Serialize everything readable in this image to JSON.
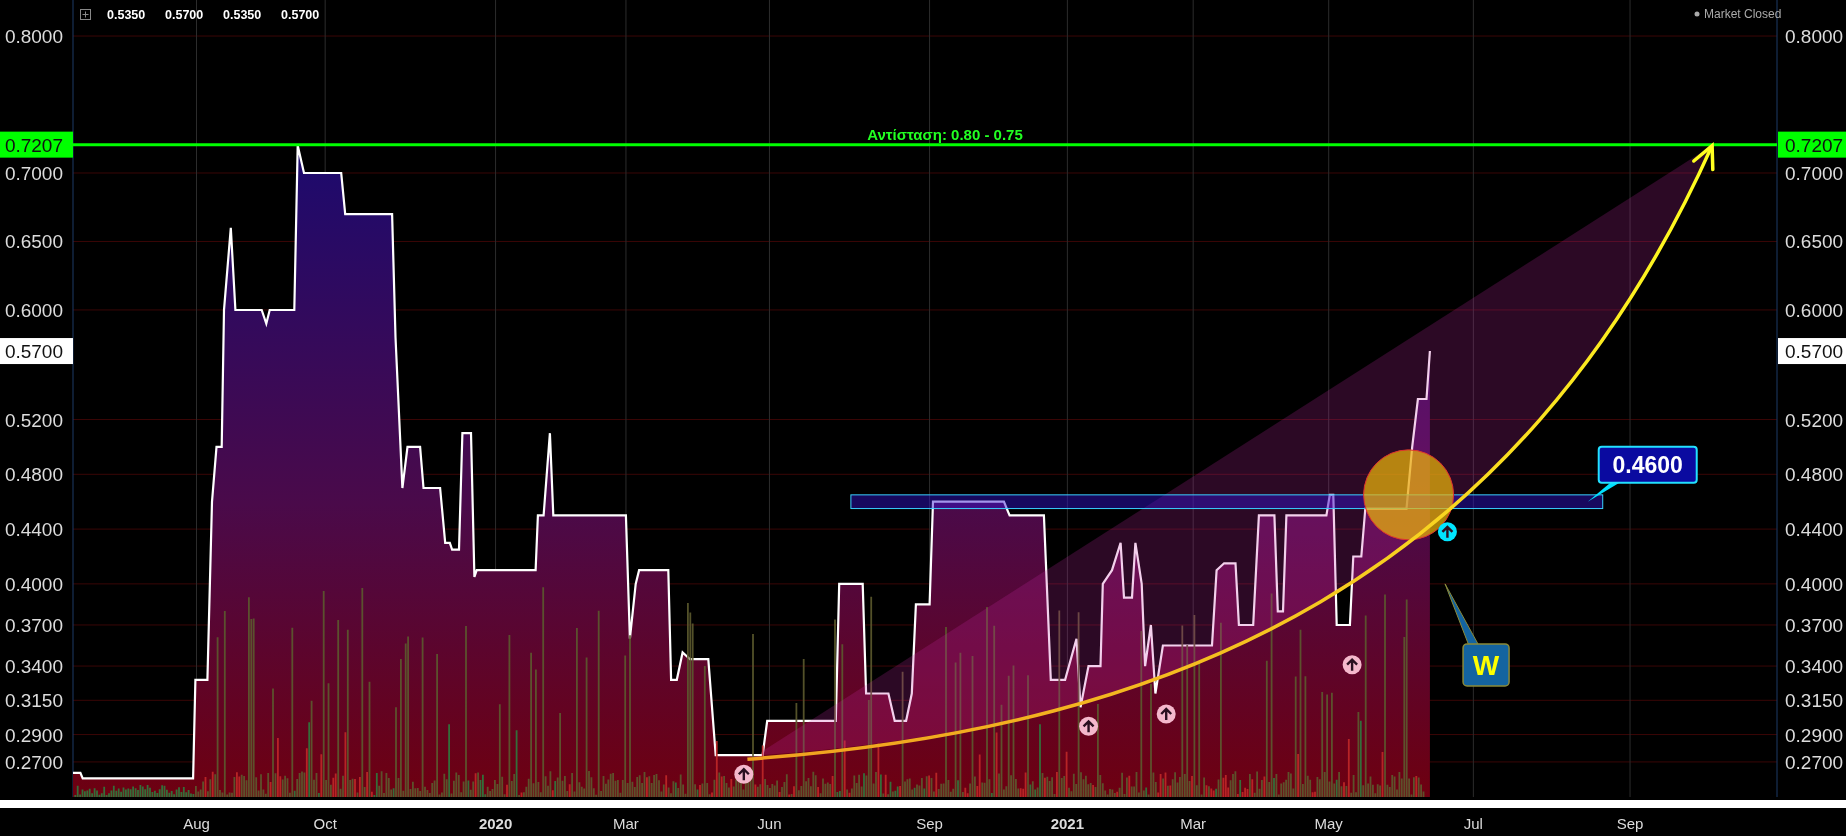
{
  "header": {
    "ohlc": [
      "0.5350",
      "0.5700",
      "0.5350",
      "0.5700"
    ],
    "market_status": "Market Closed"
  },
  "left_tags": [
    {
      "kind": "resistance",
      "label": "0.7207"
    },
    {
      "kind": "last",
      "label": "0.5700"
    }
  ],
  "right_tags": [
    {
      "kind": "resistance",
      "label": "0.7207"
    },
    {
      "kind": "last",
      "label": "0.5700"
    }
  ],
  "chart_data": {
    "type": "area",
    "grid": true,
    "xlim": [
      2019.261,
      2022.241
    ],
    "ylim": [
      0.2444,
      0.8263
    ],
    "xticks": [
      {
        "value": 2019.477,
        "label": "Aug"
      },
      {
        "value": 2019.702,
        "label": "Oct"
      },
      {
        "value": 2020,
        "label": "2020"
      },
      {
        "value": 2020.228,
        "label": "Mar"
      },
      {
        "value": 2020.479,
        "label": "Jun"
      },
      {
        "value": 2020.759,
        "label": "Sep"
      },
      {
        "value": 2021,
        "label": "2021"
      },
      {
        "value": 2021.22,
        "label": "Mar"
      },
      {
        "value": 2021.457,
        "label": "May"
      },
      {
        "value": 2021.71,
        "label": "Jul"
      },
      {
        "value": 2021.984,
        "label": "Sep"
      }
    ],
    "yticks": [
      {
        "value": 0.8,
        "label": "0.8000"
      },
      {
        "value": 0.7,
        "label": "0.7000"
      },
      {
        "value": 0.65,
        "label": "0.6500"
      },
      {
        "value": 0.6,
        "label": "0.6000"
      },
      {
        "value": 0.52,
        "label": "0.5200"
      },
      {
        "value": 0.48,
        "label": "0.4800"
      },
      {
        "value": 0.44,
        "label": "0.4400"
      },
      {
        "value": 0.4,
        "label": "0.4000"
      },
      {
        "value": 0.37,
        "label": "0.3700"
      },
      {
        "value": 0.34,
        "label": "0.3400"
      },
      {
        "value": 0.315,
        "label": "0.3150"
      },
      {
        "value": 0.29,
        "label": "0.2900"
      },
      {
        "value": 0.27,
        "label": "0.2700"
      }
    ],
    "x": [
      2019.261,
      2019.274,
      2019.278,
      2019.471,
      2019.475,
      2019.496,
      2019.504,
      2019.512,
      2019.521,
      2019.525,
      2019.537,
      2019.545,
      2019.591,
      2019.599,
      2019.605,
      2019.648,
      2019.654,
      2019.665,
      2019.73,
      2019.737,
      2019.819,
      2019.825,
      2019.837,
      2019.846,
      2019.868,
      2019.874,
      2019.903,
      2019.912,
      2019.92,
      2019.924,
      2019.936,
      2019.942,
      2019.957,
      2019.963,
      2019.967,
      2020.07,
      2020.074,
      2020.084,
      2020.095,
      2020.101,
      2020.228,
      2020.235,
      2020.245,
      2020.251,
      2020.302,
      2020.307,
      2020.317,
      2020.327,
      2020.34,
      2020.372,
      2020.385,
      2020.467,
      2020.475,
      2020.595,
      2020.601,
      2020.642,
      2020.648,
      2020.687,
      2020.698,
      2020.718,
      2020.728,
      2020.735,
      2020.759,
      2020.765,
      2020.889,
      2020.899,
      2020.959,
      2020.971,
      2020.996,
      2021.016,
      2021.023,
      2021.037,
      2021.058,
      2021.062,
      2021.078,
      2021.093,
      2021.099,
      2021.113,
      2021.119,
      2021.13,
      2021.136,
      2021.146,
      2021.154,
      2021.167,
      2021.253,
      2021.261,
      2021.274,
      2021.294,
      2021.3,
      2021.325,
      2021.335,
      2021.362,
      2021.368,
      2021.377,
      2021.383,
      2021.453,
      2021.459,
      2021.465,
      2021.471,
      2021.494,
      2021.5,
      2021.514,
      2021.521,
      2021.593,
      2021.603,
      2021.613,
      2021.628,
      2021.634
    ],
    "series": [
      {
        "color": "#ffffff",
        "values": [
          0.262,
          0.262,
          0.258,
          0.258,
          0.33,
          0.33,
          0.46,
          0.5,
          0.5,
          0.6,
          0.66,
          0.6,
          0.6,
          0.59,
          0.6,
          0.6,
          0.72,
          0.7,
          0.7,
          0.67,
          0.67,
          0.58,
          0.47,
          0.5,
          0.5,
          0.47,
          0.47,
          0.43,
          0.43,
          0.425,
          0.425,
          0.51,
          0.51,
          0.405,
          0.41,
          0.41,
          0.45,
          0.45,
          0.51,
          0.45,
          0.45,
          0.36,
          0.4,
          0.41,
          0.41,
          0.33,
          0.33,
          0.35,
          0.345,
          0.345,
          0.275,
          0.275,
          0.3,
          0.3,
          0.4,
          0.4,
          0.32,
          0.32,
          0.3,
          0.3,
          0.32,
          0.385,
          0.385,
          0.46,
          0.46,
          0.45,
          0.45,
          0.33,
          0.33,
          0.36,
          0.31,
          0.34,
          0.34,
          0.4,
          0.41,
          0.43,
          0.39,
          0.39,
          0.43,
          0.4,
          0.34,
          0.37,
          0.32,
          0.355,
          0.355,
          0.41,
          0.415,
          0.415,
          0.37,
          0.37,
          0.45,
          0.45,
          0.38,
          0.38,
          0.45,
          0.45,
          0.465,
          0.465,
          0.37,
          0.37,
          0.42,
          0.42,
          0.455,
          0.455,
          0.5,
          0.535,
          0.535,
          0.57
        ]
      }
    ]
  },
  "overlays": [
    {
      "kind": "channel"
    },
    {
      "kind": "hline",
      "label": "Αντίσταση: 0.80 - 0.75"
    },
    {
      "kind": "zone",
      "label": "0.4600"
    },
    {
      "kind": "circle"
    },
    {
      "kind": "arrow"
    },
    {
      "kind": "callout",
      "label": "W"
    },
    {
      "kind": "marker",
      "color": "#f4b8cc"
    },
    {
      "kind": "marker",
      "color": "#f4b8cc"
    },
    {
      "kind": "marker",
      "color": "#f4b8cc"
    },
    {
      "kind": "marker",
      "color": "#f4b8cc"
    },
    {
      "kind": "marker",
      "color": "#00e5ff"
    }
  ]
}
